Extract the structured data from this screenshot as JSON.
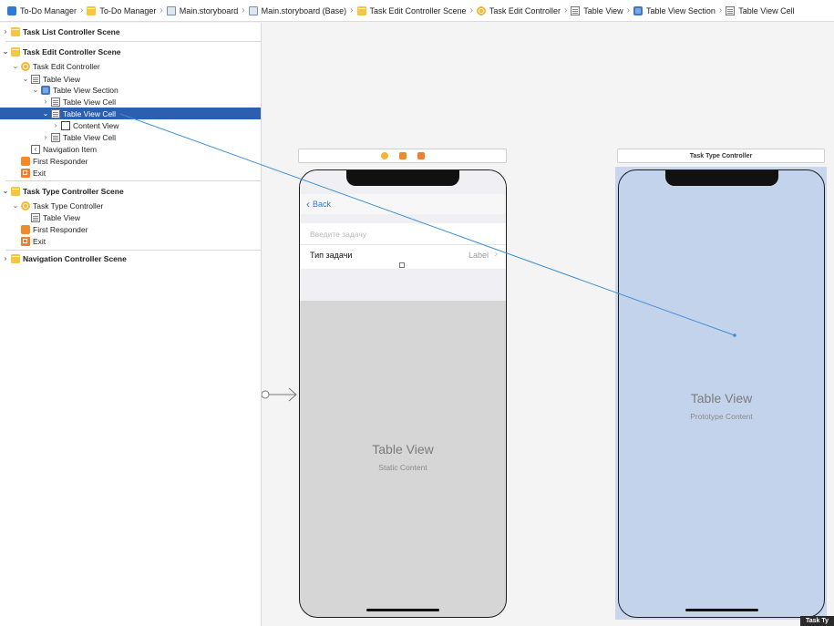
{
  "breadcrumb": {
    "items": [
      {
        "label": "To-Do Manager",
        "icon": "app-icon"
      },
      {
        "label": "To-Do Manager",
        "icon": "folder-icon"
      },
      {
        "label": "Main.storyboard",
        "icon": "storyboard-icon"
      },
      {
        "label": "Main.storyboard (Base)",
        "icon": "storyboard-icon"
      },
      {
        "label": "Task Edit Controller Scene",
        "icon": "scene-icon"
      },
      {
        "label": "Task Edit Controller",
        "icon": "controller-icon"
      },
      {
        "label": "Table View",
        "icon": "table-view-icon"
      },
      {
        "label": "Table View Section",
        "icon": "table-section-icon"
      },
      {
        "label": "Table View Cell",
        "icon": "table-cell-icon"
      }
    ]
  },
  "outline": {
    "rows": [
      {
        "label": "Task List Controller Scene",
        "kind": "scene",
        "expanded": false
      },
      {
        "label": "Task Edit Controller Scene",
        "kind": "scene",
        "expanded": true
      },
      {
        "label": "Task Edit Controller",
        "kind": "controller",
        "expanded": true
      },
      {
        "label": "Table View",
        "kind": "table",
        "expanded": true
      },
      {
        "label": "Table View Section",
        "kind": "section",
        "expanded": true
      },
      {
        "label": "Table View Cell",
        "kind": "table",
        "expanded": false
      },
      {
        "label": "Table View Cell",
        "kind": "table",
        "expanded": true,
        "selected": true
      },
      {
        "label": "Content View",
        "kind": "view",
        "expanded": false
      },
      {
        "label": "Table View Cell",
        "kind": "table",
        "expanded": false
      },
      {
        "label": "Navigation Item",
        "kind": "nav"
      },
      {
        "label": "First Responder",
        "kind": "responder"
      },
      {
        "label": "Exit",
        "kind": "exit"
      },
      {
        "label": "Task Type Controller Scene",
        "kind": "scene",
        "expanded": true
      },
      {
        "label": "Task Type Controller",
        "kind": "controller",
        "expanded": true
      },
      {
        "label": "Table View",
        "kind": "table"
      },
      {
        "label": "First Responder",
        "kind": "responder"
      },
      {
        "label": "Exit",
        "kind": "exit"
      },
      {
        "label": "Navigation Controller Scene",
        "kind": "scene",
        "expanded": false
      }
    ]
  },
  "canvas": {
    "edit_scene": {
      "back_label": "Back",
      "placeholder": "Введите задачу",
      "type_label": "Тип задачи",
      "detail_label": "Label",
      "table_title": "Table View",
      "table_subtitle": "Static Content"
    },
    "type_scene": {
      "bar_title": "Task Type Controller",
      "table_title": "Table View",
      "table_subtitle": "Prototype Content"
    },
    "bottom_tab": "Task Ty"
  },
  "colors": {
    "selection": "#2c5faf",
    "accent_blue": "#2e7ad8",
    "scene_yellow": "#f6c542",
    "connection_line": "#3a8fd6",
    "highlight_fill": "#c9d7ee"
  }
}
